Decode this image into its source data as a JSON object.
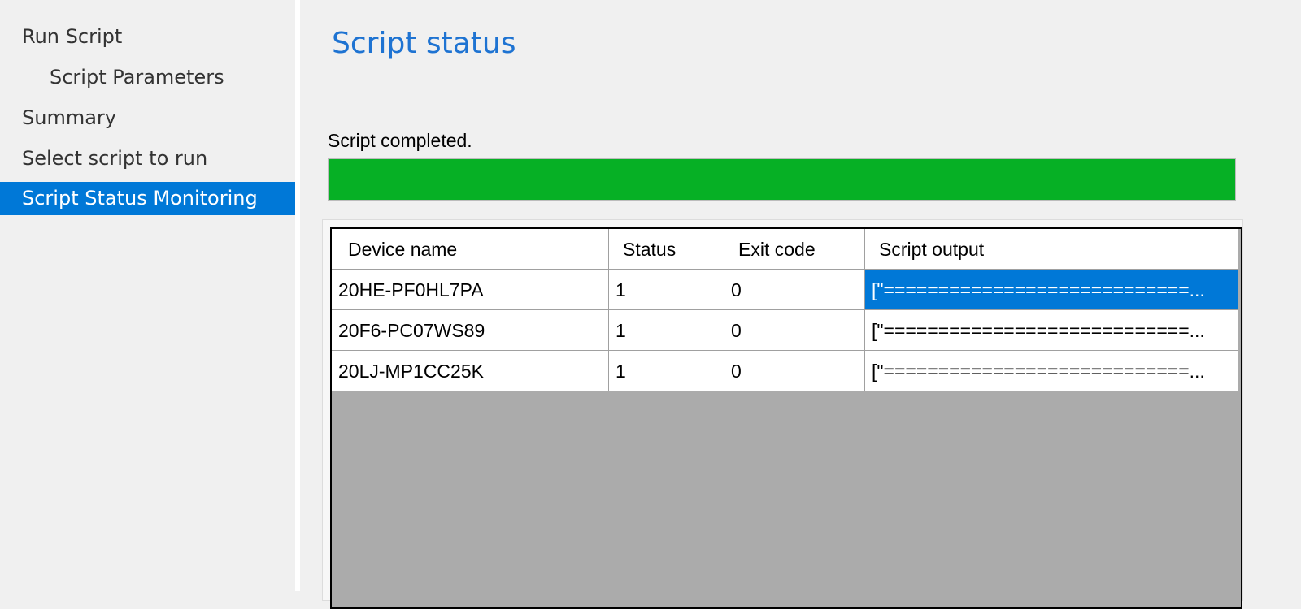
{
  "nav": {
    "items": [
      {
        "label": "Run Script"
      },
      {
        "label": "Script Parameters"
      },
      {
        "label": "Summary"
      },
      {
        "label": "Select script to run"
      },
      {
        "label": "Script Status Monitoring"
      }
    ],
    "active_index": 4
  },
  "main": {
    "title": "Script status",
    "status_text": "Script completed.",
    "progress_percent": 100,
    "progress_color": "#06b025"
  },
  "grid": {
    "columns": [
      "Device name",
      "Status",
      "Exit code",
      "Script output"
    ],
    "rows": [
      [
        "20HE-PF0HL7PA",
        "1",
        "0",
        "[\"============================..."
      ],
      [
        "20F6-PC07WS89",
        "1",
        "0",
        "[\"============================..."
      ],
      [
        "20LJ-MP1CC25K",
        "1",
        "0",
        "[\"============================..."
      ]
    ],
    "selected_row": 0,
    "selected_column": 3
  },
  "colors": {
    "accent": "#0078d7",
    "title": "#1e73d2",
    "progress": "#06b025",
    "grid_empty": "#ababab"
  }
}
